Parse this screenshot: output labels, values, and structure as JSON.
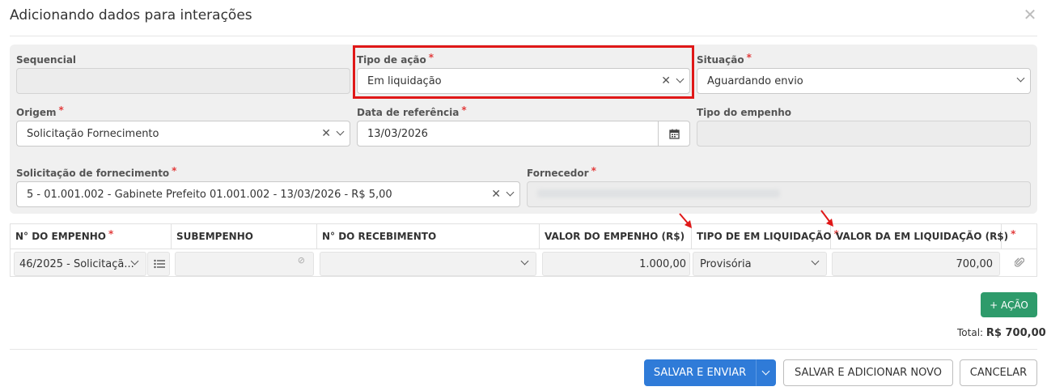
{
  "dialog": {
    "title": "Adicionando dados para interações",
    "close_icon": "close-icon"
  },
  "form": {
    "sequencial": {
      "label": "Sequencial",
      "value": ""
    },
    "tipo_acao": {
      "label": "Tipo de ação",
      "required": "*",
      "value": "Em liquidação"
    },
    "situacao": {
      "label": "Situação",
      "required": "*",
      "value": "Aguardando envio"
    },
    "origem": {
      "label": "Origem",
      "required": "*",
      "value": "Solicitação Fornecimento"
    },
    "data_referencia": {
      "label": "Data de referência",
      "required": "*",
      "value": "13/03/2026"
    },
    "tipo_empenho": {
      "label": "Tipo do empenho",
      "value": ""
    },
    "solicitacao": {
      "label": "Solicitação de fornecimento",
      "required": "*",
      "value": "5 - 01.001.002 - Gabinete Prefeito 01.001.002 - 13/03/2026 - R$ 5,00"
    },
    "fornecedor": {
      "label": "Fornecedor",
      "required": "*",
      "value": ""
    }
  },
  "table": {
    "headers": {
      "empenho": "N° DO EMPENHO",
      "subempenho": "SUBEMPENHO",
      "recebimento": "N° DO RECEBIMENTO",
      "valor_empenho": "VALOR DO EMPENHO (R$)",
      "tipo_liquidacao": "TIPO DE EM LIQUIDAÇÃO",
      "valor_liquidacao": "VALOR DA EM LIQUIDAÇÃO (R$)"
    },
    "required_mark": "*",
    "row": {
      "empenho": "46/2025 - Solicitaçã...",
      "subempenho": "",
      "recebimento": "",
      "valor_empenho": "1.000,00",
      "tipo_liquidacao": "Provisória",
      "valor_liquidacao": "700,00"
    }
  },
  "actions": {
    "add_action_label": "+ AÇÃO",
    "total_label": "Total:",
    "total_value": "R$ 700,00",
    "save_send_label": "SALVAR E ENVIAR",
    "save_add_new_label": "SALVAR E ADICIONAR NOVO",
    "cancel_label": "CANCELAR"
  },
  "colors": {
    "primary": "#2f7bd8",
    "success": "#2e9b6b",
    "highlight": "#e01818",
    "required": "#e23c3c"
  }
}
